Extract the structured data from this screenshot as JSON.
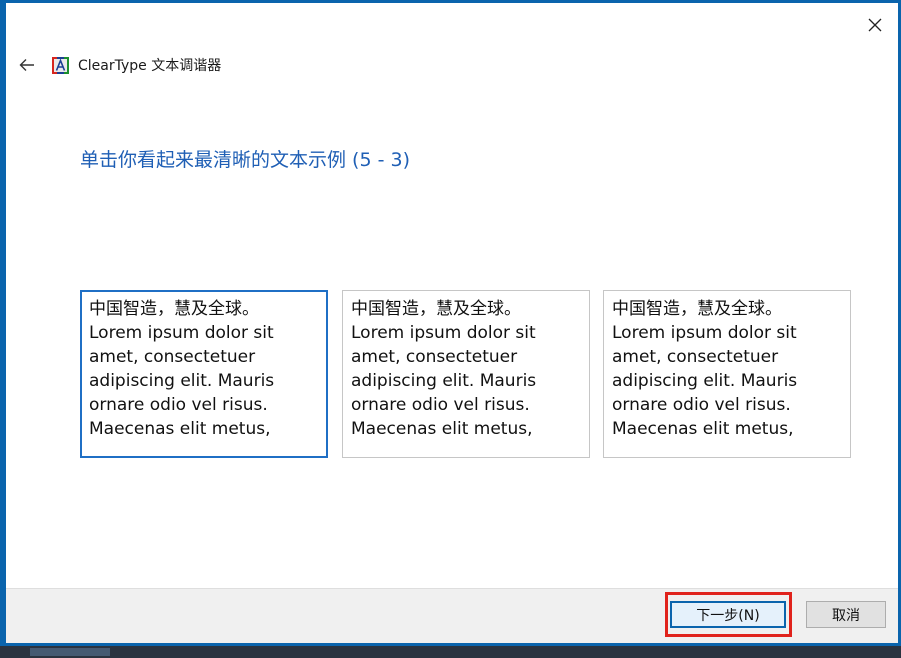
{
  "window": {
    "app_title": "ClearType 文本调谐器",
    "close_icon": "close-icon",
    "back_icon": "back-arrow-icon",
    "app_icon": "cleartype-icon"
  },
  "instruction": "单击你看起来最清晰的文本示例 (5 - 3)",
  "samples": [
    {
      "lines": [
        "中国智造，慧及全球。",
        "Lorem ipsum dolor sit",
        "amet, consectetuer",
        "adipiscing elit. Mauris",
        "ornare odio vel risus.",
        "Maecenas elit metus,"
      ],
      "selected": true
    },
    {
      "lines": [
        "中国智造，慧及全球。",
        "Lorem ipsum dolor sit",
        "amet, consectetuer",
        "adipiscing elit. Mauris",
        "ornare odio vel risus.",
        "Maecenas elit metus,"
      ],
      "selected": false
    },
    {
      "lines": [
        "中国智造，慧及全球。",
        "Lorem ipsum dolor sit",
        "amet, consectetuer",
        "adipiscing elit. Mauris",
        "ornare odio vel risus.",
        "Maecenas elit metus,"
      ],
      "selected": false
    }
  ],
  "footer": {
    "next_label": "下一步(N)",
    "cancel_label": "取消"
  },
  "colors": {
    "accent": "#0a64ad",
    "instruction_text": "#1f5fb5",
    "highlight": "#e0221b"
  }
}
